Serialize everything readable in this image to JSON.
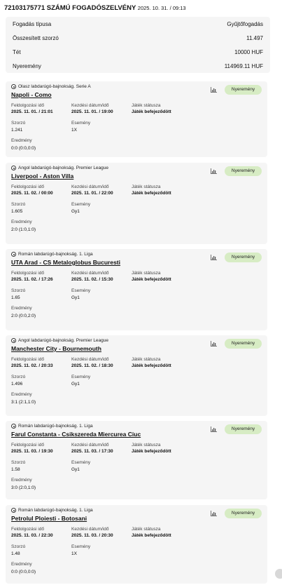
{
  "header": {
    "title": "72103175771 SZÁMÚ FOGADÓSZELVÉNY",
    "datetime": "2025. 10. 31. / 09:13"
  },
  "summary": [
    {
      "label": "Fogadás típusa",
      "value": "Gyűjtőfogadás"
    },
    {
      "label": "Összesített szorzó",
      "value": "11.497"
    },
    {
      "label": "Tét",
      "value": "10000 HUF"
    },
    {
      "label": "Nyeremény",
      "value": "114969.11 HUF"
    }
  ],
  "labels": {
    "processed": "Feldolgozási idő",
    "start": "Kezdési dátum/idő",
    "game_status": "Játék státusza",
    "odds": "Szorzó",
    "event": "Esemény",
    "result": "Eredmény"
  },
  "icons": {
    "chart": "bar-chart-icon",
    "league": "soccer-ball-icon",
    "scroll": "scroll-button-icon"
  },
  "colors": {
    "badge_bg": "#d7ecc4",
    "card_bg": "#f5f5f5"
  },
  "bets": [
    {
      "league": "Olasz labdarúgó-bajnokság. Serie A",
      "match": "Napoli - Como",
      "badge": "Nyeremény",
      "processed": "2025. 11. 01. / 21:01",
      "start": "2025. 11. 01. / 19:00",
      "status": "Játék befejeződött",
      "odds": "1.241",
      "event": "1X",
      "result": "0:0 (0:0,0:0)"
    },
    {
      "league": "Angol labdarúgó-bajnokság. Premier League",
      "match": "Liverpool - Aston Villa",
      "badge": "Nyeremény",
      "processed": "2025. 11. 02. / 00:00",
      "start": "2025. 11. 01. / 22:00",
      "status": "Játék befejeződött",
      "odds": "1.605",
      "event": "Gy1",
      "result": "2:0 (1:0,1:0)"
    },
    {
      "league": "Román labdarúgó-bajnokság. 1. Liga",
      "match": "UTA Arad - CS Metaloglobus Bucuresti",
      "badge": "Nyeremény",
      "processed": "2025. 11. 02. / 17:26",
      "start": "2025. 11. 02. / 15:30",
      "status": "Játék befejeződött",
      "odds": "1.65",
      "event": "Gy1",
      "result": "2:0 (0:0,2:0)"
    },
    {
      "league": "Angol labdarúgó-bajnokság. Premier League",
      "match": "Manchester City - Bournemouth",
      "badge": "Nyeremény",
      "processed": "2025. 11. 02. / 20:33",
      "start": "2025. 11. 02. / 18:30",
      "status": "Játék befejeződött",
      "odds": "1.496",
      "event": "Gy1",
      "result": "3:1 (2:1,1:0)"
    },
    {
      "league": "Román labdarúgó-bajnokság. 1. Liga",
      "match": "Farul Constanta - Csikszereda Miercurea Ciuc",
      "badge": "Nyeremény",
      "processed": "2025. 11. 03. / 19:30",
      "start": "2025. 11. 03. / 17:30",
      "status": "Játék befejeződött",
      "odds": "1.58",
      "event": "Gy1",
      "result": "3:0 (2:0,1:0)"
    },
    {
      "league": "Román labdarúgó-bajnokság. 1. Liga",
      "match": "Petrolul Ploiesti - Botosani",
      "badge": "Nyeremény",
      "processed": "2025. 11. 03. / 22:30",
      "start": "2025. 11. 03. / 20:30",
      "status": "Játék befejeződött",
      "odds": "1.48",
      "event": "1X",
      "result": "0:0 (0:0,0:0)"
    }
  ]
}
